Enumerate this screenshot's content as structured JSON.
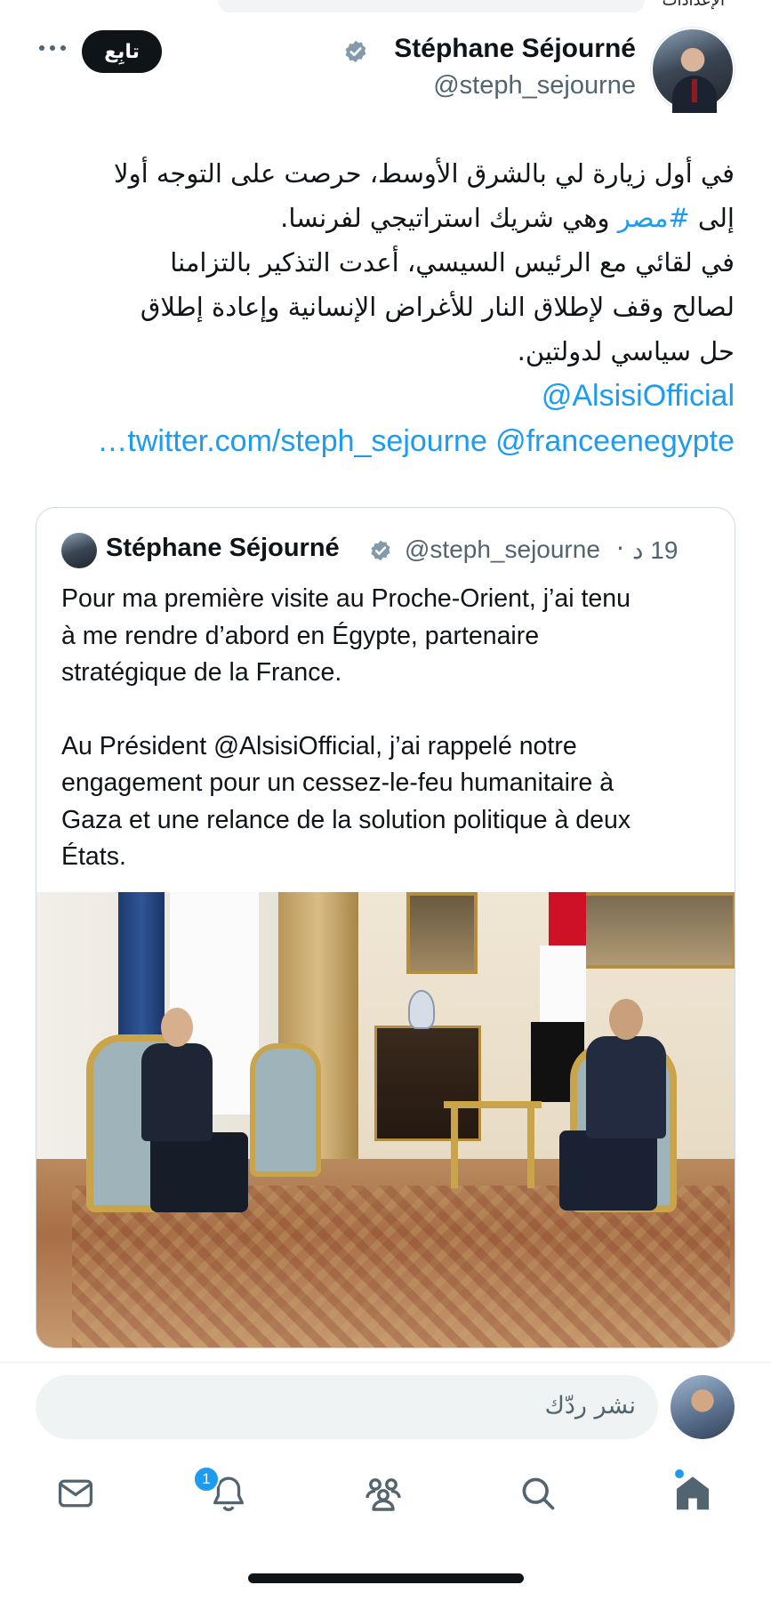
{
  "top_bar": {
    "settings_label_partial": "الإعدادات"
  },
  "tweet": {
    "author_name": "Stéphane Séjourné",
    "author_handle": "@steph_sejourne",
    "follow_label": "تابِع",
    "lines": [
      {
        "text": "في أول زيارة لي بالشرق الأوسط، حرصت على التوجه أولا"
      },
      {
        "pre": "إلى ",
        "hashtag": "#مصر",
        "post": " وهي شريك استراتيجي لفرنسا."
      },
      {
        "text": "في لقائي مع الرئيس السيسي، أعدت التذكير بالتزامنا"
      },
      {
        "text": "لصالح وقف لإطلاق النار للأغراض الإنسانية وإعادة إطلاق"
      },
      {
        "text": "حل سياسي لدولتين."
      }
    ],
    "mention_1": "@AlsisiOfficial",
    "mention_2": "@franceenegypte",
    "truncated_link": "…twitter.com/steph_sejourne"
  },
  "quoted_tweet": {
    "author_name": "Stéphane Séjourné",
    "author_handle": "@steph_sejourne",
    "separator": "·",
    "time": "19 د",
    "paragraph_1": "Pour ma première visite au Proche-Orient, j’ai tenu\nà me rendre d’abord en Égypte, partenaire\nstratégique de la France.",
    "paragraph_2": "Au Président @AlsisiOfficial, j’ai rappelé notre\nengagement pour un cessez-le-feu humanitaire à\nGaza et une relance de la solution politique à deux\nÉtats."
  },
  "reply": {
    "placeholder": "نشر ردّك"
  },
  "bottom_nav": {
    "items": [
      "messages-icon",
      "notifications-icon",
      "communities-icon",
      "search-icon",
      "home-icon"
    ],
    "notification_count": "1"
  },
  "colors": {
    "accent": "#1d9bf0",
    "text": "#0f1419",
    "secondary": "#536471",
    "border": "#cfd9de"
  }
}
